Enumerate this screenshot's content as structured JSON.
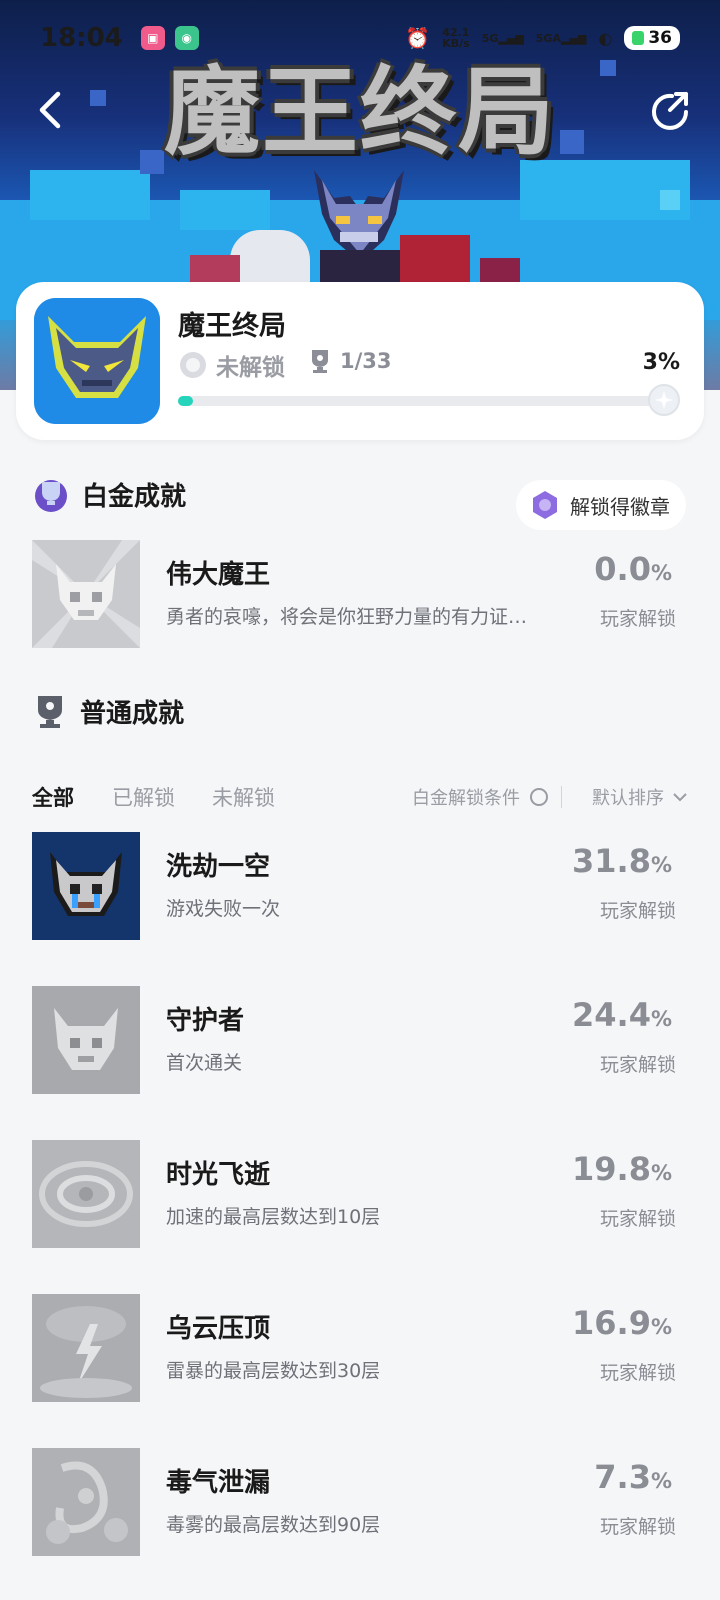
{
  "status_bar": {
    "time": "18:04",
    "network_speed_value": "42.1",
    "network_speed_unit": "KB/s",
    "signal_1": "5G",
    "signal_2": "5GA",
    "battery": "36"
  },
  "banner": {
    "title": "魔王终局"
  },
  "game": {
    "name": "魔王终局",
    "unlock_status": "未解锁",
    "trophy_count": "1/33",
    "progress_label": "3%",
    "progress": 0.03
  },
  "platinum": {
    "heading": "白金成就",
    "badge_button": "解锁得徽章",
    "item": {
      "title": "伟大魔王",
      "desc": "勇者的哀嚎，将会是你狂野力量的有力证…",
      "percent": "0.0",
      "pct_sign": "%",
      "sub": "玩家解锁"
    }
  },
  "normal": {
    "heading": "普通成就",
    "tabs": [
      "全部",
      "已解锁",
      "未解锁"
    ],
    "condition_label": "白金解锁条件",
    "sort_label": "默认排序",
    "items": [
      {
        "title": "洗劫一空",
        "desc": "游戏失败一次",
        "percent": "31.8",
        "pct_sign": "%",
        "sub": "玩家解锁"
      },
      {
        "title": "守护者",
        "desc": "首次通关",
        "percent": "24.4",
        "pct_sign": "%",
        "sub": "玩家解锁"
      },
      {
        "title": "时光飞逝",
        "desc": "加速的最高层数达到10层",
        "percent": "19.8",
        "pct_sign": "%",
        "sub": "玩家解锁"
      },
      {
        "title": "乌云压顶",
        "desc": "雷暴的最高层数达到30层",
        "percent": "16.9",
        "pct_sign": "%",
        "sub": "玩家解锁"
      },
      {
        "title": "毒气泄漏",
        "desc": "毒雾的最高层数达到90层",
        "percent": "7.3",
        "pct_sign": "%",
        "sub": "玩家解锁"
      }
    ]
  },
  "colors": {
    "accent": "#26d3bb",
    "page_bg": "#f5f6f8",
    "muted": "#8a8d94"
  }
}
